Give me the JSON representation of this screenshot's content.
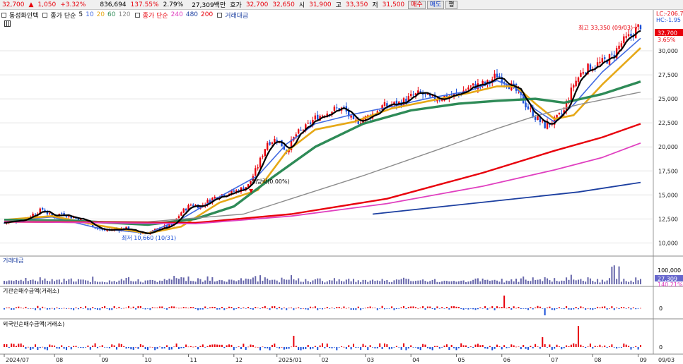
{
  "quote": {
    "price": "32,700",
    "change": "1,050",
    "change_pct": "+3.32%",
    "volume": "836,694",
    "vol_ratio": "137.55%",
    "turnover": "2.79%",
    "amount": "27,309백만",
    "ask_label": "호가",
    "ask": "32,700",
    "bid": "32,650",
    "open_label": "시",
    "open": "31,900",
    "high_label": "고",
    "high": "33,350",
    "low_label": "저",
    "low": "31,500",
    "buy_btn": "매수",
    "sell_btn": "매도",
    "extra_btn": "평"
  },
  "legend": {
    "stock_name": "동성화인텍",
    "ma_short_label": "종가 단순",
    "ma_short_periods": [
      "5",
      "10",
      "20",
      "60",
      "120"
    ],
    "ma_long_label": "종가 단순",
    "ma_long_periods": [
      "240",
      "480",
      "200"
    ],
    "amount_label": "거래대금",
    "lc_label": "LC:-206.75",
    "hc_label": "HC:-1.95"
  },
  "colors": {
    "up": "#e8000b",
    "down": "#1a4fd8",
    "ma5": "#000000",
    "ma10": "#4169e1",
    "ma20": "#e6a817",
    "ma60": "#2e8b57",
    "ma120": "#8c8c8c",
    "ma240": "#e8000b",
    "ma480": "#e040c0",
    "ma200": "#1c3fa0"
  },
  "panels": {
    "volume_title": "거래대금",
    "volume_tick": "100,000",
    "volume_last": "27,309",
    "volume_pct": "140.21%",
    "inst_title": "기관순매수금액(거래소)",
    "inst_tick": "0",
    "foreign_title": "외국인순매수금액(거래소)",
    "foreign_tick": "0"
  },
  "chart_data": {
    "type": "candlestick",
    "x_ticks": [
      "2024/07",
      "08",
      "09",
      "10",
      "11",
      "12",
      "2025/01",
      "02",
      "03",
      "04",
      "05",
      "06",
      "07",
      "08",
      "09",
      "09/03"
    ],
    "y_ticks": [
      "30,000",
      "27,500",
      "25,000",
      "22,500",
      "20,000",
      "17,500",
      "15,000",
      "12,500",
      "10,000"
    ],
    "y_values": [
      30000,
      27500,
      25000,
      22500,
      20000,
      17500,
      15000,
      12500,
      10000
    ],
    "ylim": [
      9000,
      32500
    ],
    "last_price_label": "32,700",
    "last_change_label": "3.65%",
    "annotations": {
      "high": "최고 33,350 (09/03)",
      "low": "최저 10,660 (10/31)",
      "dividend": "배당락(0.00%)"
    },
    "close_path": [
      [
        0,
        12100
      ],
      [
        8,
        12500
      ],
      [
        12,
        13000
      ],
      [
        16,
        13500
      ],
      [
        20,
        12700
      ],
      [
        24,
        13100
      ],
      [
        28,
        12700
      ],
      [
        33,
        12400
      ],
      [
        37,
        11800
      ],
      [
        41,
        11300
      ],
      [
        46,
        11400
      ],
      [
        51,
        11500
      ],
      [
        55,
        11100
      ],
      [
        59,
        11000
      ],
      [
        62,
        11200
      ],
      [
        66,
        11600
      ],
      [
        70,
        11800
      ],
      [
        74,
        13200
      ],
      [
        78,
        14000
      ],
      [
        82,
        13800
      ],
      [
        86,
        14500
      ],
      [
        90,
        15000
      ],
      [
        94,
        15200
      ],
      [
        98,
        15500
      ],
      [
        102,
        16000
      ],
      [
        106,
        18000
      ],
      [
        110,
        20500
      ],
      [
        114,
        20800
      ],
      [
        118,
        19600
      ],
      [
        122,
        21300
      ],
      [
        126,
        22000
      ],
      [
        130,
        23000
      ],
      [
        134,
        23500
      ],
      [
        138,
        23900
      ],
      [
        142,
        24000
      ],
      [
        146,
        22500
      ],
      [
        150,
        22900
      ],
      [
        154,
        23400
      ],
      [
        158,
        24200
      ],
      [
        162,
        24400
      ],
      [
        166,
        24600
      ],
      [
        170,
        25200
      ],
      [
        174,
        25600
      ],
      [
        178,
        25000
      ],
      [
        182,
        25100
      ],
      [
        186,
        25300
      ],
      [
        190,
        25500
      ],
      [
        194,
        26200
      ],
      [
        198,
        26400
      ],
      [
        202,
        26600
      ],
      [
        206,
        27500
      ],
      [
        210,
        26700
      ],
      [
        214,
        25800
      ],
      [
        218,
        24400
      ],
      [
        222,
        23100
      ],
      [
        226,
        22200
      ],
      [
        230,
        22700
      ],
      [
        234,
        23700
      ],
      [
        238,
        26500
      ],
      [
        242,
        28000
      ],
      [
        246,
        28400
      ],
      [
        250,
        28800
      ],
      [
        254,
        29400
      ],
      [
        258,
        30800
      ],
      [
        262,
        31600
      ],
      [
        266,
        32700
      ]
    ],
    "moving_averages": [
      {
        "period": 10,
        "points": [
          [
            0,
            12300
          ],
          [
            20,
            12700
          ],
          [
            40,
            11500
          ],
          [
            60,
            11000
          ],
          [
            74,
            12500
          ],
          [
            90,
            14800
          ],
          [
            106,
            17000
          ],
          [
            118,
            20300
          ],
          [
            130,
            22400
          ],
          [
            146,
            23400
          ],
          [
            162,
            24200
          ],
          [
            178,
            25100
          ],
          [
            194,
            25800
          ],
          [
            206,
            26900
          ],
          [
            214,
            26100
          ],
          [
            222,
            23900
          ],
          [
            230,
            22600
          ],
          [
            238,
            24400
          ],
          [
            250,
            27800
          ],
          [
            266,
            31300
          ]
        ]
      },
      {
        "period": 20,
        "points": [
          [
            0,
            12400
          ],
          [
            20,
            12800
          ],
          [
            40,
            11800
          ],
          [
            60,
            11000
          ],
          [
            74,
            11700
          ],
          [
            90,
            14200
          ],
          [
            106,
            15500
          ],
          [
            118,
            19500
          ],
          [
            130,
            21800
          ],
          [
            146,
            22600
          ],
          [
            162,
            24000
          ],
          [
            178,
            24800
          ],
          [
            194,
            25600
          ],
          [
            206,
            26300
          ],
          [
            214,
            26300
          ],
          [
            222,
            24500
          ],
          [
            230,
            22900
          ],
          [
            238,
            23300
          ],
          [
            250,
            26500
          ],
          [
            266,
            30300
          ]
        ]
      },
      {
        "period": 60,
        "points": [
          [
            0,
            12400
          ],
          [
            30,
            12300
          ],
          [
            60,
            11900
          ],
          [
            80,
            12500
          ],
          [
            96,
            13800
          ],
          [
            112,
            16800
          ],
          [
            130,
            20000
          ],
          [
            150,
            22400
          ],
          [
            170,
            23800
          ],
          [
            190,
            24500
          ],
          [
            206,
            24800
          ],
          [
            222,
            25000
          ],
          [
            234,
            24600
          ],
          [
            250,
            25500
          ],
          [
            266,
            26800
          ]
        ]
      },
      {
        "period": 120,
        "points": [
          [
            0,
            12300
          ],
          [
            60,
            12200
          ],
          [
            100,
            13000
          ],
          [
            120,
            14600
          ],
          [
            150,
            17000
          ],
          [
            180,
            19600
          ],
          [
            206,
            21900
          ],
          [
            222,
            23200
          ],
          [
            240,
            24400
          ],
          [
            266,
            25700
          ]
        ]
      },
      {
        "period": 240,
        "points": [
          [
            0,
            12200
          ],
          [
            80,
            12100
          ],
          [
            120,
            13000
          ],
          [
            160,
            14600
          ],
          [
            200,
            17300
          ],
          [
            230,
            19600
          ],
          [
            250,
            21000
          ],
          [
            266,
            22400
          ]
        ]
      },
      {
        "period": 480,
        "points": [
          [
            0,
            12200
          ],
          [
            80,
            12000
          ],
          [
            120,
            12800
          ],
          [
            160,
            14100
          ],
          [
            200,
            15900
          ],
          [
            230,
            17600
          ],
          [
            250,
            18900
          ],
          [
            266,
            20400
          ]
        ]
      },
      {
        "period": 200,
        "points": [
          [
            154,
            13000
          ],
          [
            180,
            13700
          ],
          [
            210,
            14500
          ],
          [
            240,
            15300
          ],
          [
            266,
            16300
          ]
        ]
      }
    ]
  }
}
